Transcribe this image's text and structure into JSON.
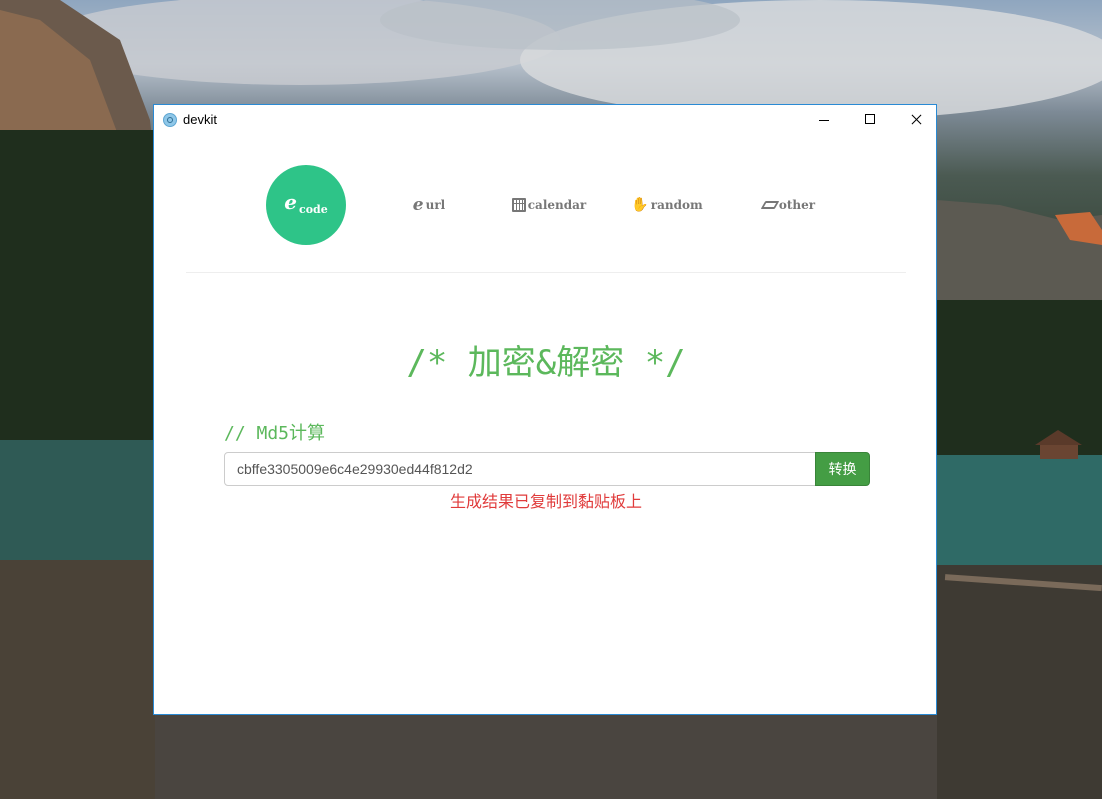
{
  "window": {
    "title": "devkit"
  },
  "nav": {
    "items": [
      {
        "label": "code",
        "icon": "ie-icon",
        "active": true
      },
      {
        "label": "url",
        "icon": "ie-icon",
        "active": false
      },
      {
        "label": "calendar",
        "icon": "calendar-icon",
        "active": false
      },
      {
        "label": "random",
        "icon": "hand-icon",
        "active": false
      },
      {
        "label": "other",
        "icon": "eraser-icon",
        "active": false
      }
    ],
    "active_color": "#2ec488"
  },
  "main": {
    "title": "/* 加密&解密 */",
    "section_label": "// Md5计算",
    "input_value": "cbffe3305009e6c4e29930ed44f812d2",
    "convert_button": "转换",
    "status_message": "生成结果已复制到黏贴板上",
    "accent_color": "#5cb85c",
    "status_color": "#e03b3b"
  }
}
